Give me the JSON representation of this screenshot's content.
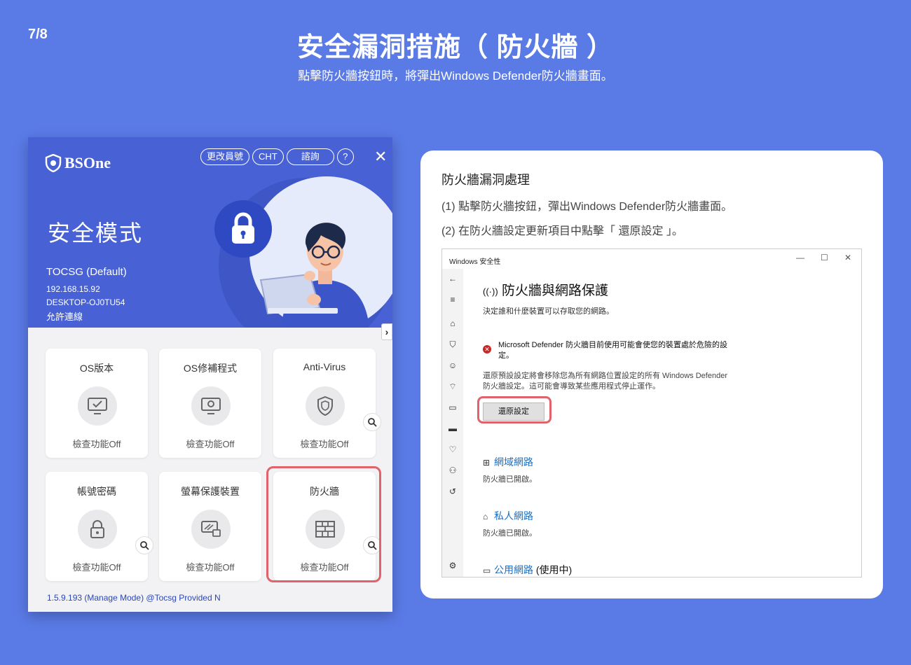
{
  "page": {
    "number": "7/8",
    "title": "安全漏洞措施（ 防火牆 ）",
    "subtitle": "點擊防火牆按鈕時，將彈出Windows Defender防火牆畫面。"
  },
  "app": {
    "logo_text": "BSOne",
    "buttons": {
      "change_id": "更改員號",
      "lang": "CHT",
      "consult": "諮詢",
      "help": "?",
      "close": "✕"
    },
    "mode_title": "安全模式",
    "profile": "TOCSG (Default)",
    "ip": "192.168.15.92",
    "device": "DESKTOP-OJ0TU54",
    "connection": "允許連線",
    "cards": [
      {
        "title": "OS版本",
        "status": "檢查功能Off",
        "icon": "monitor-icon"
      },
      {
        "title": "OS修補程式",
        "status": "檢查功能Off",
        "icon": "patch-monitor-icon"
      },
      {
        "title": "Anti-Virus",
        "status": "檢查功能Off",
        "icon": "shield-icon"
      },
      {
        "title": "帳號密碼",
        "status": "檢查功能Off",
        "icon": "lock-icon"
      },
      {
        "title": "螢幕保護裝置",
        "status": "檢查功能Off",
        "icon": "screensaver-icon"
      },
      {
        "title": "防火牆",
        "status": "檢查功能Off",
        "icon": "firewall-icon"
      }
    ],
    "version": "1.5.9.193 (Manage Mode) @Tocsg Provided N"
  },
  "panel": {
    "heading": "防火牆漏洞處理",
    "step1": "(1) 點擊防火牆按鈕，彈出Windows Defender防火牆畫面。",
    "step2": "(2) 在防火牆設定更新項目中點擊「 還原設定 」。"
  },
  "win": {
    "title": "Windows 安全性",
    "controls": {
      "minimize": "—",
      "maximize": "☐",
      "close": "✕"
    },
    "heading": "防火牆與網路保護",
    "desc": "決定誰和什麼裝置可以存取您的網路。",
    "warning": "Microsoft Defender 防火牆目前使用可能會使您的裝置處於危險的設定。",
    "info": "還原預設設定將會移除您為所有網路位置設定的所有 Windows Defender 防火牆設定。這可能會導致某些應用程式停止運作。",
    "restore_button": "還原設定",
    "networks": [
      {
        "name": "網域網路",
        "status": "防火牆已開啟。",
        "extra": ""
      },
      {
        "name": "私人網路",
        "status": "防火牆已開啟。",
        "extra": ""
      },
      {
        "name": "公用網路",
        "status": "",
        "extra": "(使用中)"
      }
    ]
  },
  "colors": {
    "background": "#5a7ae6",
    "app_header": "#4862d6",
    "highlight": "#e0636b",
    "link": "#1a6fc4"
  }
}
